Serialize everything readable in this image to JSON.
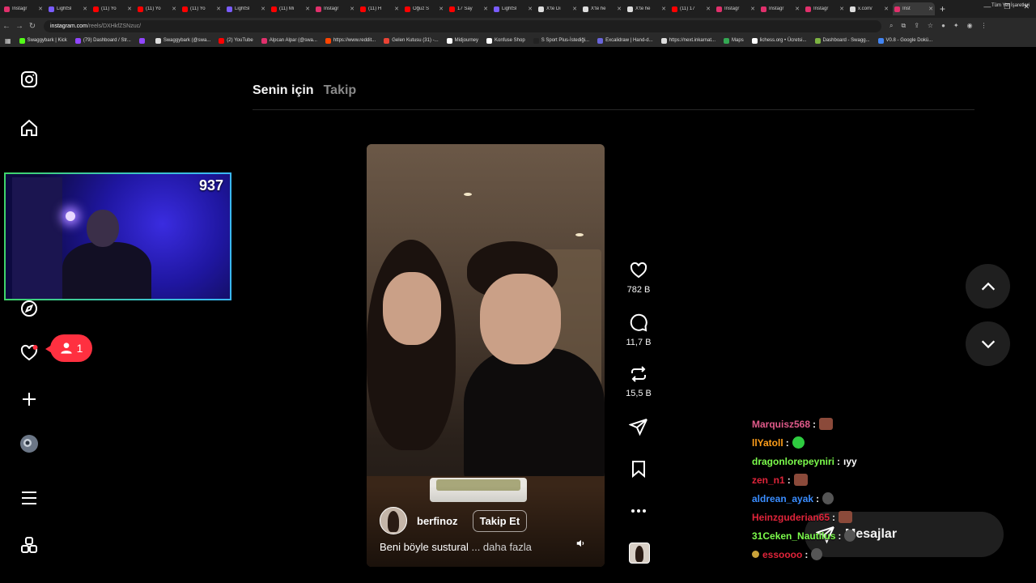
{
  "browser": {
    "tabs": [
      {
        "label": "Instagr",
        "color": "#e1306c",
        "active": false
      },
      {
        "label": "LightSl",
        "color": "#7a5cff",
        "active": false
      },
      {
        "label": "(11) Yo",
        "color": "#ff0000",
        "active": false
      },
      {
        "label": "(11) Yo",
        "color": "#ff0000",
        "active": false
      },
      {
        "label": "(11) Yo",
        "color": "#ff0000",
        "active": false
      },
      {
        "label": "LightSl",
        "color": "#7a5cff",
        "active": false
      },
      {
        "label": "(11) Mi",
        "color": "#ff0000",
        "active": false
      },
      {
        "label": "Instagr",
        "color": "#e1306c",
        "active": false
      },
      {
        "label": "(11) H",
        "color": "#ff0000",
        "active": false
      },
      {
        "label": "Oğuz S",
        "color": "#ff0000",
        "active": false
      },
      {
        "label": "17 Say",
        "color": "#ff0000",
        "active": false
      },
      {
        "label": "LightSl",
        "color": "#7a5cff",
        "active": false
      },
      {
        "label": "X'te Dı",
        "color": "#dddddd",
        "active": false
      },
      {
        "label": "X'te he",
        "color": "#dddddd",
        "active": false
      },
      {
        "label": "X'te he",
        "color": "#dddddd",
        "active": false
      },
      {
        "label": "(11) 17",
        "color": "#ff0000",
        "active": false
      },
      {
        "label": "Instagr",
        "color": "#e1306c",
        "active": false
      },
      {
        "label": "Instagr",
        "color": "#e1306c",
        "active": false
      },
      {
        "label": "Instagr",
        "color": "#e1306c",
        "active": false
      },
      {
        "label": "x.com/",
        "color": "#dddddd",
        "active": false
      },
      {
        "label": "Inst",
        "color": "#e1306c",
        "active": true
      }
    ],
    "url_host": "instagram.com",
    "url_path": "/reels/DXHkfZSNzuc/",
    "bookmarks": [
      {
        "label": "Swaggybark | Kick",
        "color": "#53fc18"
      },
      {
        "label": "(79) Dashboard / Str...",
        "color": "#9146ff"
      },
      {
        "label": "",
        "color": "#9146ff"
      },
      {
        "label": "Swaggybark (@swa...",
        "color": "#dddddd"
      },
      {
        "label": "(2) YouTube",
        "color": "#ff0000"
      },
      {
        "label": "Alpcan Alpar (@swa...",
        "color": "#e1306c"
      },
      {
        "label": "https://www.reddit...",
        "color": "#ff4500"
      },
      {
        "label": "Gelen Kutusu (31) -...",
        "color": "#ea4335"
      },
      {
        "label": "Midjourney",
        "color": "#ffffff"
      },
      {
        "label": "Konfuse Shop",
        "color": "#ffffff"
      },
      {
        "label": "S Sport Plus-İstediği...",
        "color": "#222222"
      },
      {
        "label": "Excalidraw | Hand-d...",
        "color": "#6965db"
      },
      {
        "label": "https://next.inkarnat...",
        "color": "#dddddd"
      },
      {
        "label": "Maps",
        "color": "#34a853"
      },
      {
        "label": "lichess.org • Ücretsi...",
        "color": "#ffffff"
      },
      {
        "label": "Dashboard - Swagg...",
        "color": "#7cb342"
      },
      {
        "label": "V0.8 - Google Dokü...",
        "color": "#4285f4"
      }
    ],
    "bookmarks_all": "Tüm Yer İşaretleri"
  },
  "feed": {
    "tab_foryou": "Senin için",
    "tab_following": "Takip"
  },
  "reel": {
    "username": "berfinoz",
    "follow_label": "Takip Et",
    "caption": "Beni böyle sustural",
    "caption_more": "... daha fazla",
    "likes": "782 B",
    "comments": "11,7 B",
    "reposts": "15,5 B"
  },
  "notifications": {
    "count": "1"
  },
  "messages": {
    "label": "Mesajlar"
  },
  "stream": {
    "viewer_count": "937",
    "chat": [
      {
        "user": "Marquisz568",
        "color": "#e05a8a",
        "msg": "",
        "emote": "brown"
      },
      {
        "user": "llYatoll",
        "color": "#ff9f1a",
        "msg": "",
        "emote": "green"
      },
      {
        "user": "dragonlorepeyniri",
        "color": "#7cfc4c",
        "msg": "ıyy",
        "emote": ""
      },
      {
        "user": "zen_n1",
        "color": "#e0243a",
        "msg": "",
        "emote": "brown"
      },
      {
        "user": "aldrean_ayak",
        "color": "#3a8dff",
        "msg": "",
        "emote": "gray"
      },
      {
        "user": "Heinzguderian65",
        "color": "#e0243a",
        "msg": "",
        "emote": "brown"
      },
      {
        "user": "31Ceken_Nautilus",
        "color": "#7cfc4c",
        "msg": "",
        "emote": "gray"
      },
      {
        "user": "essoooo",
        "color": "#e0243a",
        "msg": "",
        "emote": "gray"
      }
    ]
  }
}
